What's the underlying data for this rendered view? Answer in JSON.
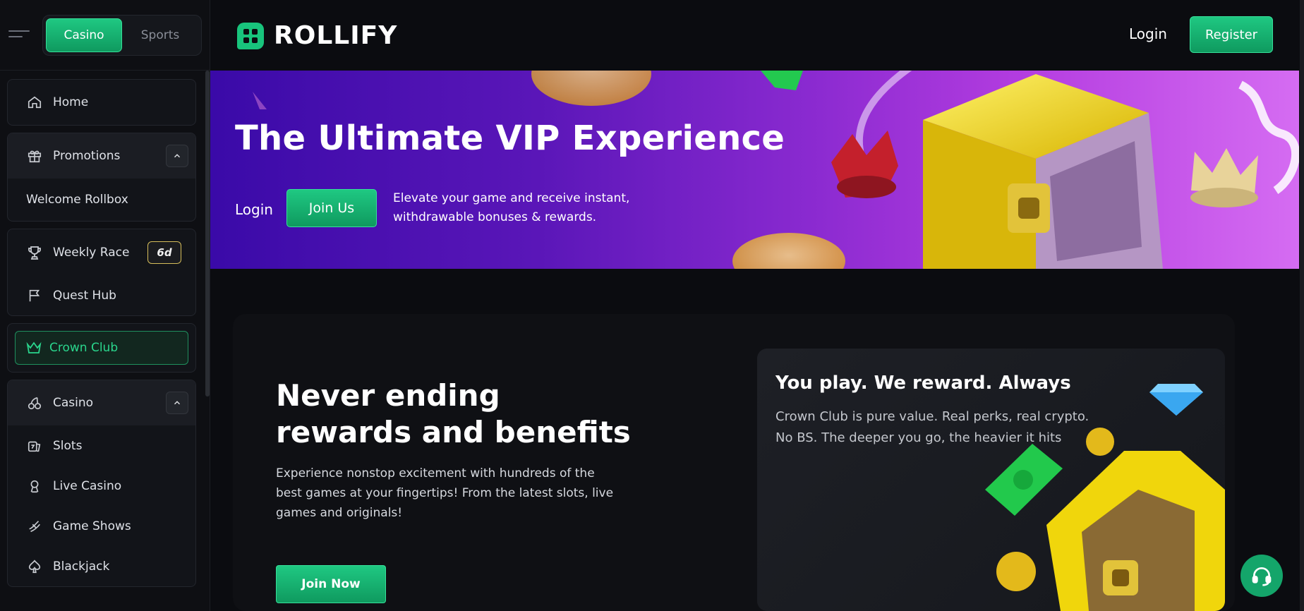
{
  "app": {
    "name": "ROLLIFY"
  },
  "mode_switch": {
    "casino": "Casino",
    "sports": "Sports",
    "active": "Casino"
  },
  "header": {
    "login": "Login",
    "register": "Register"
  },
  "sidebar": {
    "home": "Home",
    "promotions": "Promotions",
    "welcome_rollbox": "Welcome Rollbox",
    "weekly_race": "Weekly Race",
    "weekly_race_badge": "6d",
    "quest_hub": "Quest Hub",
    "crown_club": "Crown Club",
    "casino": "Casino",
    "casino_items": [
      "Slots",
      "Live Casino",
      "Game Shows",
      "Blackjack"
    ]
  },
  "hero": {
    "title": "The Ultimate VIP Experience",
    "login": "Login",
    "join": "Join Us",
    "description": "Elevate your game and receive instant, withdrawable bonuses & rewards."
  },
  "main": {
    "title": "Never ending rewards and benefits",
    "description": "Experience nonstop excitement with hundreds of the best games at your fingertips! From the latest slots, live games and originals!",
    "cta": "Join Now"
  },
  "reward_card": {
    "title": "You play. We reward. Always",
    "description": "Crown Club is pure value. Real perks, real crypto. No BS. The deeper you go, the heavier it hits"
  },
  "colors": {
    "accent": "#18c47c",
    "gold": "#f5d90a",
    "purple": "#6a1cc0"
  },
  "icons": [
    "menu-icon",
    "home-icon",
    "gift-icon",
    "trophy-icon",
    "flag-icon",
    "crown-icon",
    "cherry-icon",
    "slots-icon",
    "live-casino-icon",
    "game-shows-icon",
    "spade-icon",
    "chevron-up-icon",
    "headset-icon"
  ]
}
